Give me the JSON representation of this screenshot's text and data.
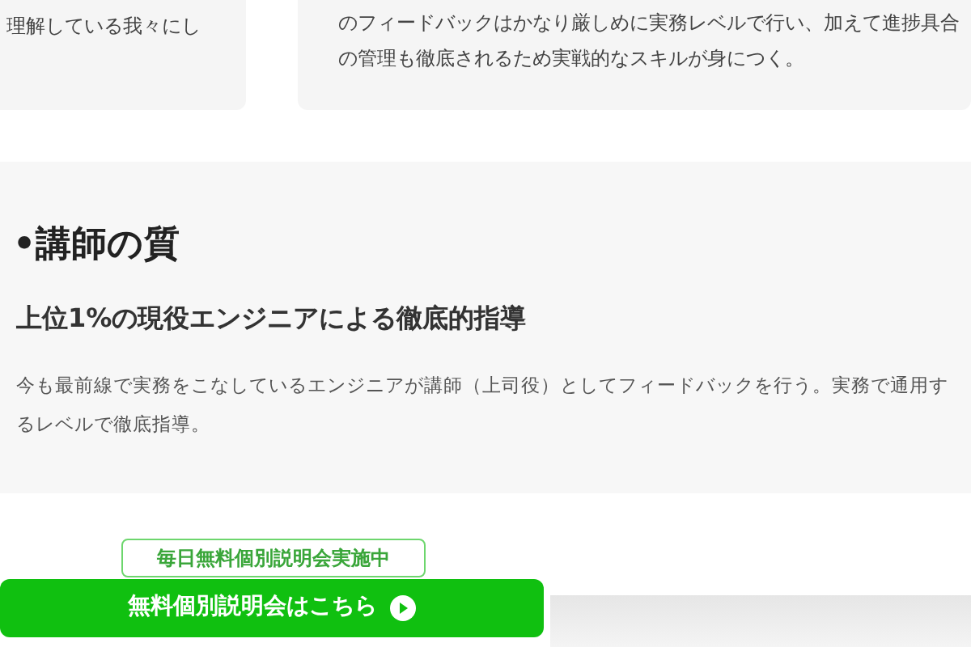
{
  "cards": [
    {
      "lines": [
        "理解している我々にし"
      ]
    },
    {
      "lines": [
        "のフィードバックはかなり厳しめに実務レベルで行い、加えて進捗具合",
        "の管理も徹底されるため実戦的なスキルが身につく。"
      ]
    }
  ],
  "section": {
    "heading": "•講師の質",
    "subheading": "上位1%の現役エンジニアによる徹底的指導",
    "body_lines": [
      "今も最前線で実務をこなしているエンジニアが講師（上司役）としてフィードバックを行う。実務で通用す",
      "るレベルで徹底指導。"
    ]
  },
  "cta": {
    "badge": "毎日無料個別説明会実施中",
    "button": "無料個別説明会はこちら"
  }
}
